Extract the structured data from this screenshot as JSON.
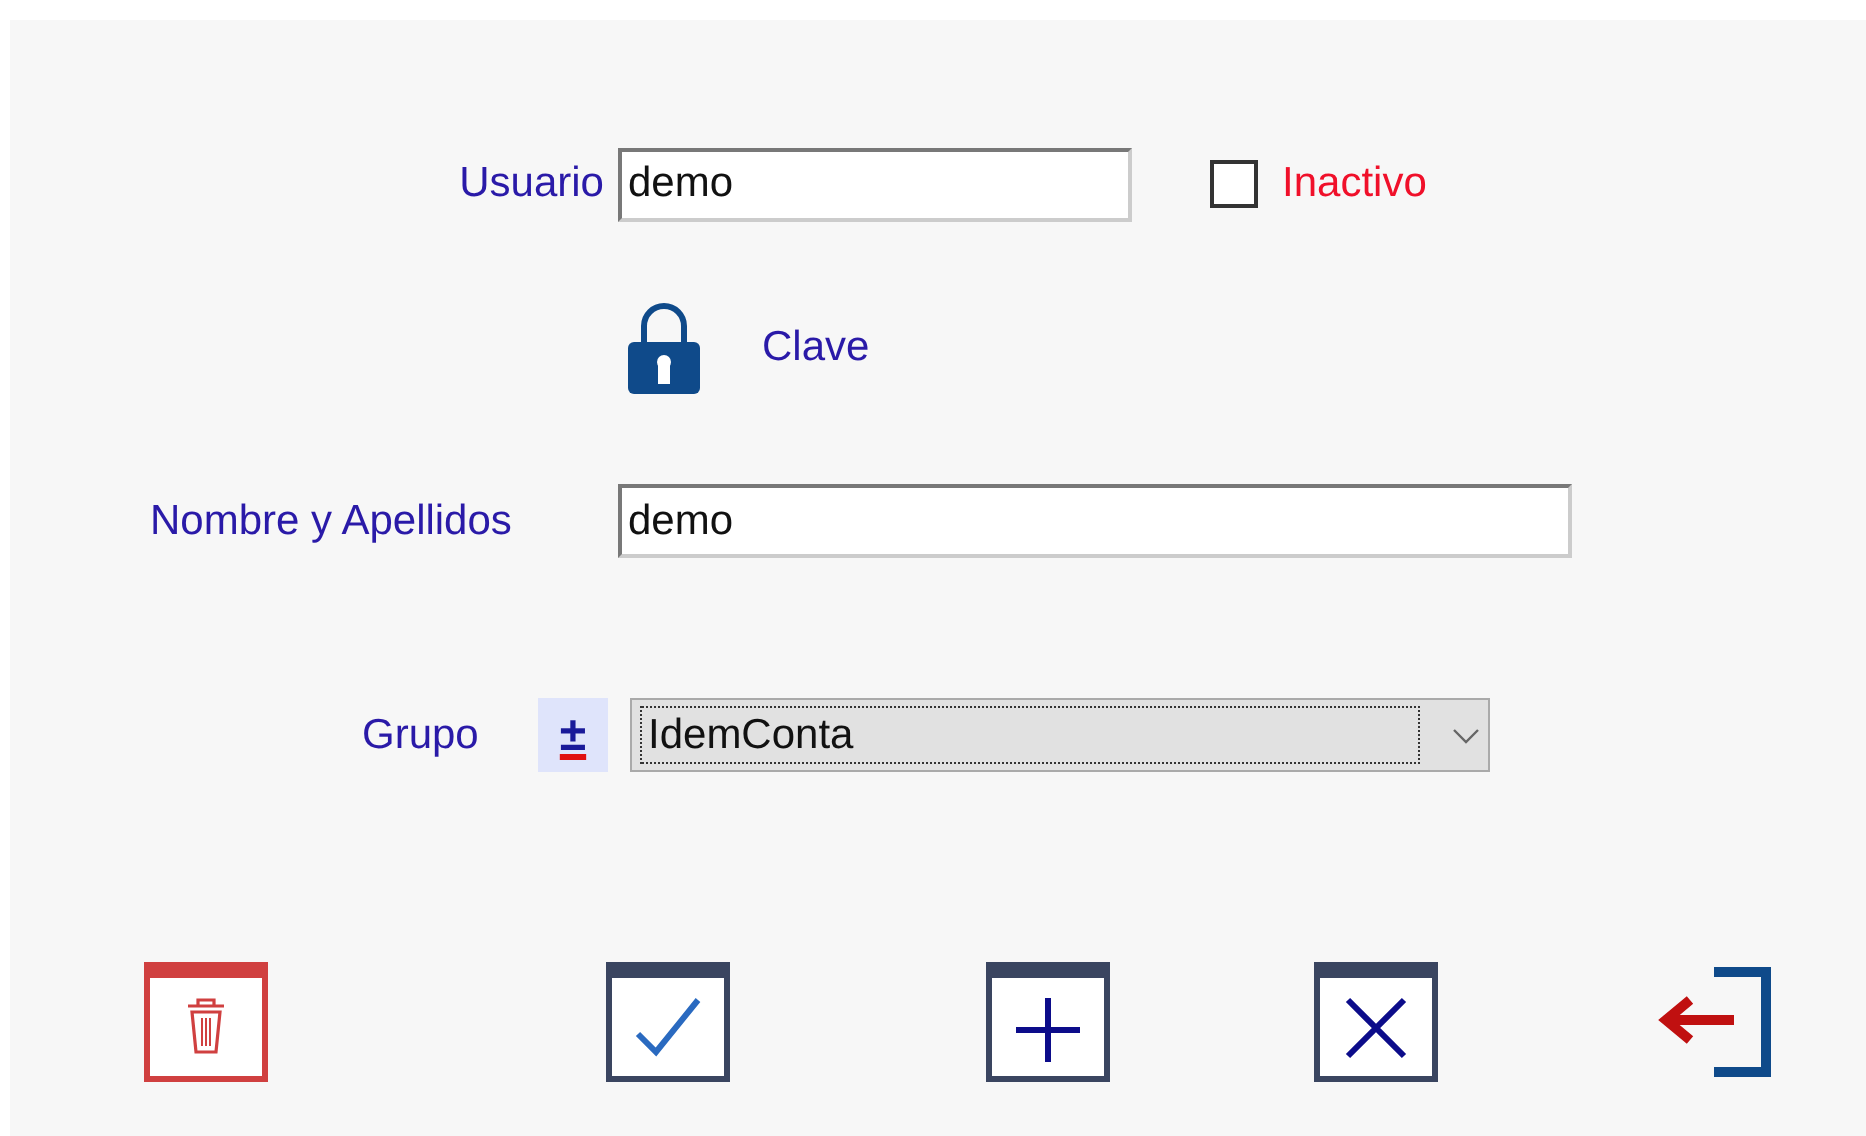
{
  "usuario": {
    "label": "Usuario",
    "value": "demo"
  },
  "inactivo": {
    "label": "Inactivo",
    "checked": false
  },
  "clave": {
    "label": "Clave"
  },
  "nombre": {
    "label": "Nombre y Apellidos",
    "value": "demo"
  },
  "grupo": {
    "label": "Grupo",
    "toggle": "±",
    "value": "IdemConta"
  },
  "actions": [
    {
      "kind": "delete"
    },
    {
      "kind": "accept"
    },
    {
      "kind": "add"
    },
    {
      "kind": "cancel"
    },
    {
      "kind": "exit"
    }
  ]
}
